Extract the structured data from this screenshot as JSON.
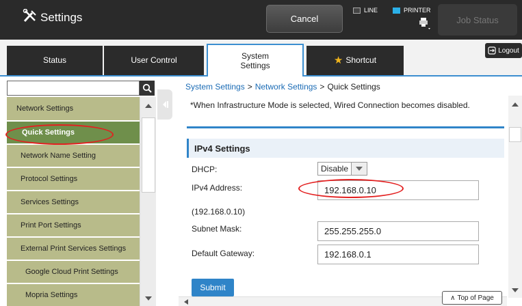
{
  "header": {
    "title": "Settings",
    "cancel_label": "Cancel",
    "modes": {
      "line": "LINE",
      "printer": "PRINTER"
    },
    "job_status_label": "Job Status",
    "icons": {
      "app": "wrench-screwdriver-icon",
      "printer": "printer-icon"
    }
  },
  "tabs": {
    "status": "Status",
    "user_control": "User Control",
    "system_settings_line1": "System",
    "system_settings_line2": "Settings",
    "shortcut": "Shortcut",
    "active": "System Settings"
  },
  "logout_label": "Logout",
  "sidebar": {
    "search_placeholder": "",
    "items": [
      {
        "label": "Network Settings"
      },
      {
        "label": "Quick Settings"
      },
      {
        "label": "Network Name Setting"
      },
      {
        "label": "Protocol Settings"
      },
      {
        "label": "Services Settings"
      },
      {
        "label": "Print Port Settings"
      },
      {
        "label": "External Print Services Settings"
      },
      {
        "label": "Google Cloud Print Settings"
      },
      {
        "label": "Mopria Settings"
      }
    ]
  },
  "breadcrumb": {
    "level1": "System Settings",
    "level2": "Network Settings",
    "current": "Quick Settings",
    "separator": ">"
  },
  "main": {
    "note": "*When Infrastructure Mode is selected, Wired Connection becomes disabled.",
    "section_title": "IPv4 Settings",
    "dhcp_label": "DHCP:",
    "dhcp_value": "Disable",
    "ipv4_label": "IPv4 Address:",
    "ipv4_value": "192.168.0.10",
    "ipv4_current": "(192.168.0.10)",
    "subnet_label": "Subnet Mask:",
    "subnet_value": "255.255.255.0",
    "gateway_label": "Default Gateway:",
    "gateway_value": "192.168.0.1",
    "submit_label": "Submit",
    "top_of_page_label": "Top of Page"
  },
  "colors": {
    "accent": "#2f84c8",
    "sidebar_item": "#b8bb8a",
    "sidebar_active": "#6f8f4b",
    "highlight": "#e32020"
  }
}
